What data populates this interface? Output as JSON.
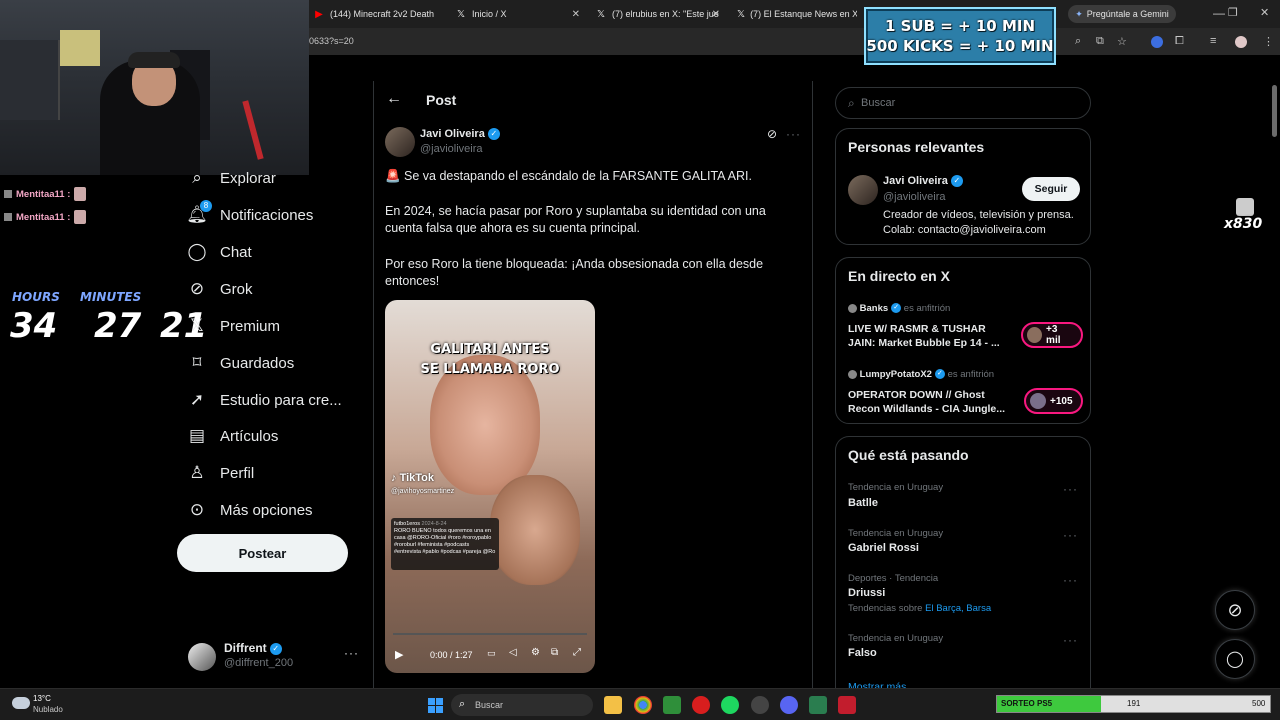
{
  "browser": {
    "tabs": [
      {
        "title": "(144) Minecraft 2v2 Death",
        "icon": "youtube-icon"
      },
      {
        "title": "Inicio / X",
        "icon": "x-logo-icon"
      },
      {
        "title": "(7) elrubius en X: \"Este jue",
        "icon": "x-logo-icon"
      },
      {
        "title": "(7) El Estanque News en X",
        "icon": "x-logo-icon"
      }
    ],
    "url_fragment": "0633?s=20",
    "gemini_label": "Pregúntale a Gemini"
  },
  "stream_overlay": {
    "promo_line1": "1 SUB = + 10 MIN",
    "promo_line2": "500 KICKS = + 10 MIN",
    "chat": [
      {
        "user": "Mentitaa11 :"
      },
      {
        "user": "Mentitaa11 :"
      }
    ],
    "timer_labels": {
      "hours": "HOURS",
      "minutes": "MINUTES"
    },
    "timer": {
      "hours": "34",
      "minutes": "27",
      "seconds": "21"
    },
    "multiplier": "x830"
  },
  "nav": {
    "items": [
      {
        "label": "Explorar",
        "icon": "search-icon"
      },
      {
        "label": "Notificaciones",
        "icon": "bell-icon",
        "badge": "8"
      },
      {
        "label": "Chat",
        "icon": "chat-icon"
      },
      {
        "label": "Grok",
        "icon": "grok-icon"
      },
      {
        "label": "Premium",
        "icon": "x-logo-icon"
      },
      {
        "label": "Guardados",
        "icon": "bookmark-icon"
      },
      {
        "label": "Estudio para cre...",
        "icon": "rocket-icon"
      },
      {
        "label": "Artículos",
        "icon": "article-icon"
      },
      {
        "label": "Perfil",
        "icon": "person-icon"
      },
      {
        "label": "Más opciones",
        "icon": "more-circle-icon"
      }
    ],
    "post_button": "Postear",
    "account": {
      "name": "Diffrent",
      "handle": "@diffrent_200"
    }
  },
  "post": {
    "header": "Post",
    "author": {
      "name": "Javi Oliveira",
      "handle": "@javioliveira"
    },
    "paragraphs": [
      "🚨 Se va destapando el escándalo de la FARSANTE GALITA ARI.",
      "En 2024, se hacía pasar por Roro y suplantaba su identidad con una cuenta falsa que ahora es su cuenta principal.",
      "Por eso Roro la tiene bloqueada: ¡Anda obsesionada con ella desde entonces!"
    ],
    "video": {
      "caption_line1": "GALITARI ANTES",
      "caption_line2": "SE LLAMABA RORO",
      "tiktok_label": "TikTok",
      "tiktok_handle": "@javihoyosmartinez",
      "inner_user": "futbo1eros",
      "inner_date": "2024-8-24",
      "inner_text": "RORO BUENO todos queremos una en casa @RORO-Oficial #roro #roroypablo #roroburl #feminista #podcasts #entrevista #pablo #podcas #pareja @Ro",
      "time": "0:00 / 1:27"
    }
  },
  "sidebar": {
    "search_placeholder": "Buscar",
    "relevant": {
      "title": "Personas relevantes",
      "name": "Javi Oliveira",
      "handle": "@javioliveira",
      "follow_label": "Seguir",
      "bio_line1": "Creador de vídeos, televisión y prensa.",
      "bio_line2": "Colab: contacto@javioliveira.com"
    },
    "live": {
      "title": "En directo en X",
      "items": [
        {
          "host": "Banks",
          "role": "es anfitrión",
          "title_line1": "LIVE W/ RASMR & TUSHAR",
          "title_line2": "JAIN: Market Bubble Ep 14 - ...",
          "count": "+3 mil"
        },
        {
          "host": "LumpyPotatoX2",
          "role": "es anfitrión",
          "title_line1": "OPERATOR DOWN // Ghost",
          "title_line2": "Recon Wildlands - CIA Jungle...",
          "count": "+105"
        }
      ]
    },
    "trends": {
      "title": "Qué está pasando",
      "items": [
        {
          "meta": "Tendencia en Uruguay",
          "name": "Batlle"
        },
        {
          "meta": "Tendencia en Uruguay",
          "name": "Gabriel Rossi"
        },
        {
          "meta": "Deportes · Tendencia",
          "name": "Driussi",
          "extra_prefix": "Tendencias sobre",
          "extra_links": "El Barça, Barsa"
        },
        {
          "meta": "Tendencia en Uruguay",
          "name": "Falso"
        }
      ],
      "show_more": "Mostrar más"
    }
  },
  "taskbar": {
    "weather_temp": "13°C",
    "weather_desc": "Nublado",
    "search_label": "Buscar",
    "goal_label": "SORTEO PS5",
    "goal_current": "191",
    "goal_target": "500",
    "goal_progress": 0.382
  }
}
